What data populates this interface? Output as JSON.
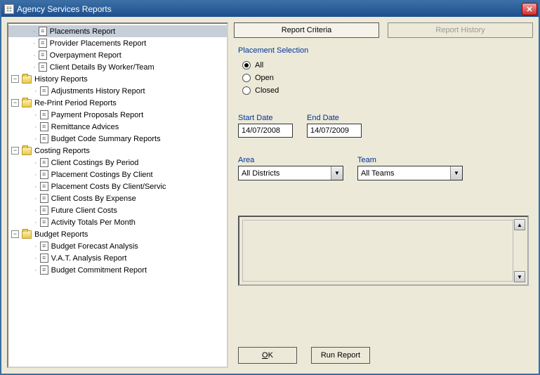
{
  "window": {
    "title": "Agency Services Reports"
  },
  "tree": {
    "selected_label": "Placements Report",
    "top_items": [
      {
        "label": "Placements Report"
      },
      {
        "label": "Provider Placements Report"
      },
      {
        "label": "Overpayment Report"
      },
      {
        "label": "Client Details By Worker/Team"
      }
    ],
    "folders": [
      {
        "label": "History Reports",
        "children": [
          {
            "label": "Adjustments History Report"
          }
        ]
      },
      {
        "label": "Re-Print Period Reports",
        "children": [
          {
            "label": "Payment Proposals Report"
          },
          {
            "label": "Remittance Advices"
          },
          {
            "label": "Budget Code Summary Reports"
          }
        ]
      },
      {
        "label": "Costing Reports",
        "children": [
          {
            "label": "Client Costings By Period"
          },
          {
            "label": "Placement Costings By Client"
          },
          {
            "label": "Placement Costs By Client/Servic"
          },
          {
            "label": "Client Costs By Expense"
          },
          {
            "label": "Future Client Costs"
          },
          {
            "label": "Activity Totals Per Month"
          }
        ]
      },
      {
        "label": "Budget Reports",
        "children": [
          {
            "label": "Budget Forecast Analysis"
          },
          {
            "label": "V.A.T. Analysis Report"
          },
          {
            "label": "Budget Commitment Report"
          }
        ]
      }
    ]
  },
  "tabs": {
    "criteria": "Report Criteria",
    "history": "Report History"
  },
  "form": {
    "group_label": "Placement Selection",
    "radios": {
      "all": "All",
      "open": "Open",
      "closed": "Closed",
      "selected": "all"
    },
    "start_date_label": "Start Date",
    "start_date": "14/07/2008",
    "end_date_label": "End Date",
    "end_date": "14/07/2009",
    "area_label": "Area",
    "area_value": "All Districts",
    "team_label": "Team",
    "team_value": "All Teams"
  },
  "buttons": {
    "ok_u": "O",
    "ok_rest": "K",
    "run": "Run Report"
  }
}
